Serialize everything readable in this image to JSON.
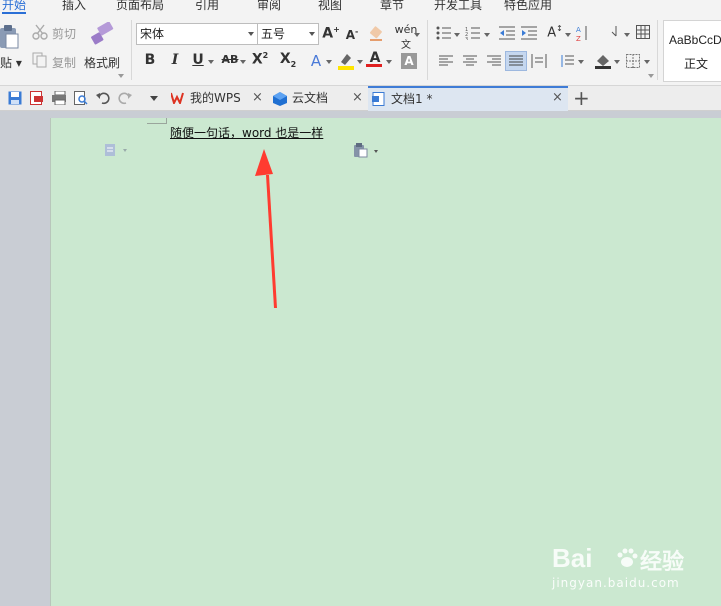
{
  "menu": {
    "tabs": [
      "开始",
      "插入",
      "页面布局",
      "引用",
      "审阅",
      "视图",
      "章节",
      "开发工具",
      "特色应用"
    ],
    "active": "开始"
  },
  "ribbon": {
    "paste_label": "贴",
    "paste_sub": "贴 ▾",
    "cut_label": "剪切",
    "copy_label": "复制",
    "format_painter_label": "格式刷",
    "font_name": "宋体",
    "font_size": "五号",
    "style_sample": "AaBbCcD",
    "style_name": "正文"
  },
  "tabs": {
    "items": [
      {
        "label": "我的WPS"
      },
      {
        "label": "云文档"
      },
      {
        "label": "文档1 *"
      }
    ],
    "active": "文档1 *"
  },
  "document": {
    "text": "随便一句话，word 也是一样"
  },
  "watermark": {
    "brand": "Bai",
    "brand_cn": "经验",
    "url": "jingyan.baidu.com"
  },
  "colors": {
    "page_background": "#cbe8d0",
    "accent": "#2a6fd6",
    "arrow": "#ff3b30",
    "highlight": "#ffe500",
    "font_color": "#e02020"
  }
}
